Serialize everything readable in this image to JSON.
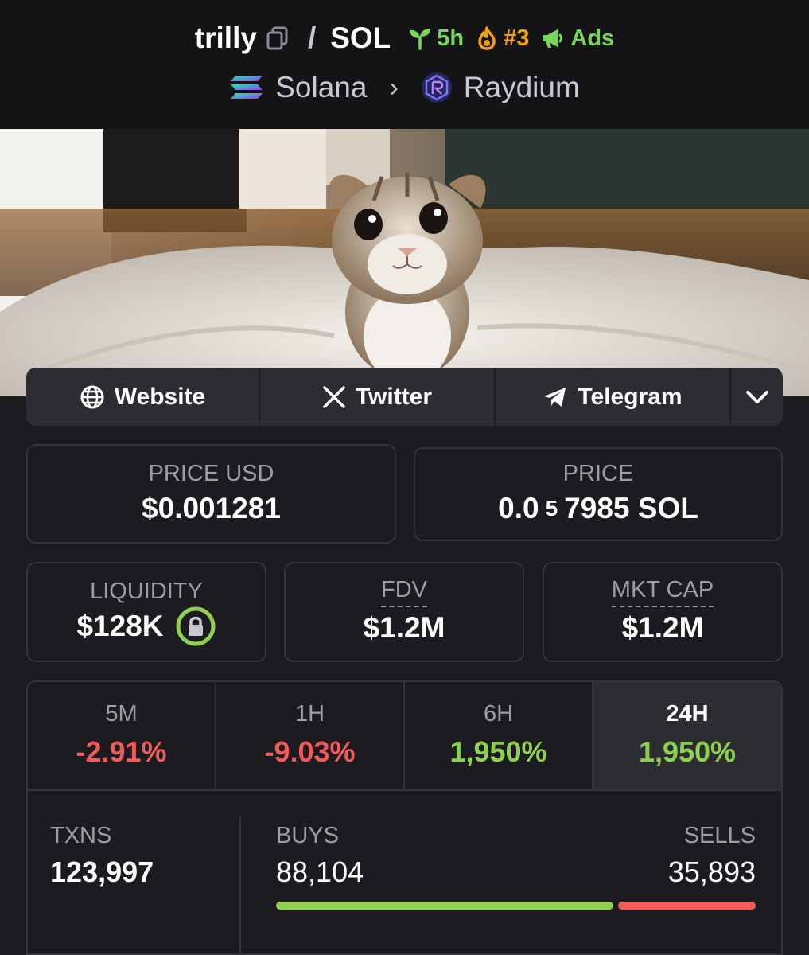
{
  "header": {
    "token": "trilly",
    "separator": "/",
    "quote": "SOL",
    "age": "5h",
    "rank": "#3",
    "ads": "Ads",
    "chain": "Solana",
    "chain_sep": "›",
    "dex": "Raydium"
  },
  "links": {
    "website": "Website",
    "twitter": "Twitter",
    "telegram": "Telegram"
  },
  "price": {
    "usd_label": "PRICE USD",
    "usd_value": "$0.001281",
    "native_label": "PRICE",
    "native_prefix": "0.0",
    "native_zeros": "5",
    "native_suffix": "7985 SOL"
  },
  "metrics": {
    "liquidity_label": "LIQUIDITY",
    "liquidity_value": "$128K",
    "fdv_label": "FDV",
    "fdv_value": "$1.2M",
    "mcap_label": "MKT CAP",
    "mcap_value": "$1.2M"
  },
  "changes": [
    {
      "label": "5M",
      "value": "-2.91%"
    },
    {
      "label": "1H",
      "value": "-9.03%"
    },
    {
      "label": "6H",
      "value": "1,950%"
    },
    {
      "label": "24H",
      "value": "1,950%"
    }
  ],
  "txns": {
    "label": "TXNS",
    "total": "123,997",
    "buys_label": "BUYS",
    "buys": "88,104",
    "sells_label": "SELLS",
    "sells": "35,893",
    "buy_ratio": 0.7105
  },
  "colors": {
    "positive": "#8fd14f",
    "negative": "#f25b5b",
    "accent_orange": "#f59e0b"
  }
}
